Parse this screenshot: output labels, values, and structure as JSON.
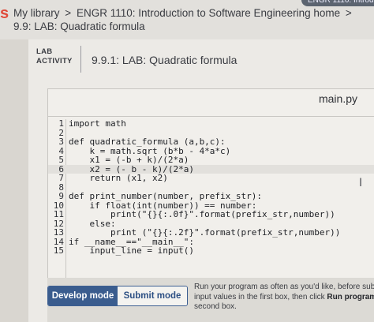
{
  "breadcrumb": {
    "library": "My library",
    "separator": ">",
    "course": "ENGR 1110: Introduction to Software Engineering home",
    "trailing_separator": ">"
  },
  "section_title": "9.9: LAB: Quadratic formula",
  "corner_tag": "ENGR 1110: Introductio",
  "lab": {
    "badge_line1": "LAB",
    "badge_line2": "ACTIVITY",
    "title": "9.9.1: LAB: Quadratic formula"
  },
  "editor": {
    "filename": "main.py",
    "lines": [
      {
        "n": "1",
        "code": "import math"
      },
      {
        "n": "2",
        "code": ""
      },
      {
        "n": "3",
        "code": "def quadratic_formula (a,b,c):"
      },
      {
        "n": "4",
        "code": "    k = math.sqrt (b*b - 4*a*c)"
      },
      {
        "n": "5",
        "code": "    x1 = (-b + k)/(2*a)"
      },
      {
        "n": "6",
        "code": "    x2 = (- b - k)/(2*a)"
      },
      {
        "n": "7",
        "code": "    return (x1, x2)"
      },
      {
        "n": "8",
        "code": ""
      },
      {
        "n": "9",
        "code": "def print_number(number, prefix_str):"
      },
      {
        "n": "10",
        "code": "    if float(int(number)) == number:"
      },
      {
        "n": "11",
        "code": "        print(\"{}{:.0f}\".format(prefix_str,number))"
      },
      {
        "n": "12",
        "code": "    else:"
      },
      {
        "n": "13",
        "code": "        print (\"{}{:.2f}\".format(prefix_str,number))"
      },
      {
        "n": "14",
        "code": "if __name__==\"__main__\":"
      },
      {
        "n": "15",
        "code": "    input_line = input()"
      }
    ]
  },
  "controls": {
    "develop_label": "Develop mode",
    "submit_label": "Submit mode",
    "help_text_1": "Run your program as often as you'd like, before sub",
    "help_text_2": "input values in the first box, then click",
    "help_bold": "Run program",
    "help_text_3": "second box."
  },
  "colors": {
    "accent": "#3a5c8e",
    "brand": "#e04a3a"
  }
}
